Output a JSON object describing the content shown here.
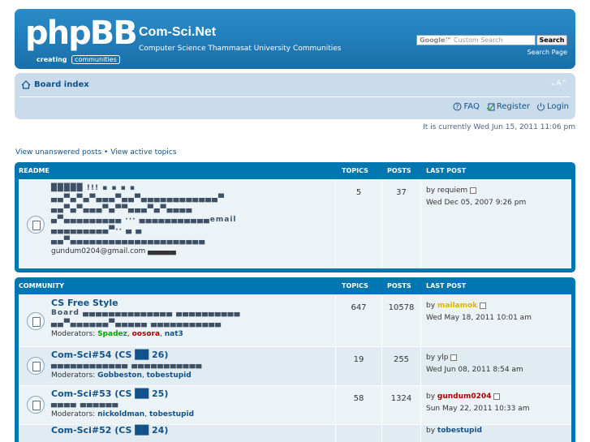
{
  "header": {
    "logo_text": "phpBB",
    "logo_sub1": "creating",
    "logo_sub2": "communities",
    "site_title": "Com-Sci.Net",
    "site_desc": "Computer Science Thammasat University Communities",
    "search_google": "Google™",
    "search_placeholder": "Custom Search",
    "search_button": "Search",
    "search_page_link": "Search Page"
  },
  "navbar": {
    "board_index": "Board index",
    "font_size_glyph": "⌄A⌃",
    "faq": "FAQ",
    "register": "Register",
    "login": "Login"
  },
  "current_time": "It is currently Wed Jun 15, 2011 11:06 pm",
  "quick_links": {
    "unanswered": "View unanswered posts",
    "separator": " • ",
    "active": "View active topics"
  },
  "sections": [
    {
      "title": "README",
      "col_topics": "TOPICS",
      "col_posts": "POSTS",
      "col_last": "LAST POST",
      "forums": [
        {
          "lines": [
            "█████ !!!  ▪  ▪      ▪      ▪",
            "▄▄▀▄▀▄▀▄▄▄▀▄▄▀▄▄▄▄▄▄▄▄▄▄▄▄▀",
            "▄▄▀▄▀▄▄▄▀▄▀▀▄▄▄▀▄▀▄▄▄▄",
            "▄▀▄▄▄▄▄▄▄▄▄ ··· ▄▄▄▄▄▄▄▄▄▄▄email",
            "▄▄▄▄▄▄▄▄▄▀··  ▄   ▄",
            "▄▄▀▄▄▄▄▄▄▄▄▄▄▄▄▄▄▄▄▄▄▄▄▄",
            "gundum0204@gmail.com ▄▄▄▄▄"
          ],
          "topics": "5",
          "posts": "37",
          "last_by": "by",
          "last_user": "requiem",
          "last_date": "Wed Dec 05, 2007 9:26 pm"
        }
      ]
    },
    {
      "title": "COMMUNITY",
      "col_topics": "TOPICS",
      "col_posts": "POSTS",
      "col_last": "LAST POST",
      "forums": [
        {
          "title": "CS Free Style",
          "lines": [
            "Board ▄▄▄▄▄▄▄▄▄▄▄▄▄▄ ▄▄▄▄▄▄▄▄▄▄",
            "▄▄▀▄▄▄▄▄▄▀▄▄▄▄▄ ▄▄▄▄▄▄▄▄▄▄▄"
          ],
          "mods_label": "Moderators:",
          "mods": [
            "Spadez",
            "oosora",
            "nat3"
          ],
          "topics": "647",
          "posts": "10578",
          "last_by": "by",
          "last_user": "mailamok",
          "last_date": "Wed May 18, 2011 10:01 am"
        },
        {
          "title": "Com-Sci#54 (CS ██ 26)",
          "lines": [
            "▄▄▄▄▄▄▄▄▄▄▄▄ ▄▄▄▄▄▄▄▄▄▄▄"
          ],
          "mods_label": "Moderators:",
          "mods": [
            "Gobbeston",
            "tobestupid"
          ],
          "topics": "19",
          "posts": "255",
          "last_by": "by",
          "last_user": "ylp",
          "last_date": "Wed Jun 08, 2011 8:54 am"
        },
        {
          "title": "Com-Sci#53 (CS ██ 25)",
          "lines": [
            "▄▄▄▄ ▄▄▄▄▄▄"
          ],
          "mods_label": "Moderators:",
          "mods": [
            "nickoldman",
            "tobestupid"
          ],
          "topics": "58",
          "posts": "1324",
          "last_by": "by",
          "last_user": "gundum0204",
          "last_date": "Sun May 22, 2011 10:33 am"
        },
        {
          "title": "Com-Sci#52 (CS ██ 24)",
          "last_by": "by",
          "last_user": "tobestupid"
        }
      ]
    }
  ]
}
